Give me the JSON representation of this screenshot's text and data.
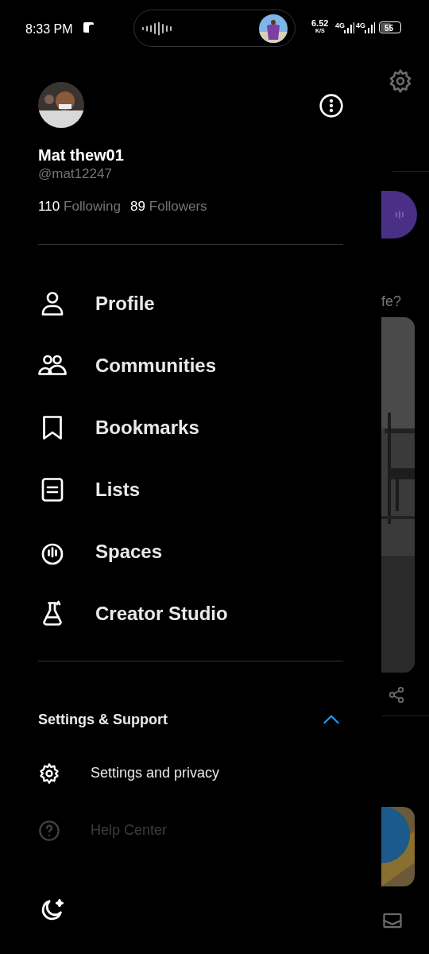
{
  "status_bar": {
    "time": "8:33 PM",
    "speed": "6.52",
    "speed_unit": "K/S",
    "network_1": "4G",
    "network_2": "4G",
    "battery": "55"
  },
  "profile": {
    "name": "Mat thew01",
    "handle": "@mat12247",
    "following_count": "110",
    "following_label": "Following",
    "followers_count": "89",
    "followers_label": "Followers"
  },
  "menu": [
    {
      "kind": "profile",
      "label": "Profile"
    },
    {
      "kind": "communities",
      "label": "Communities"
    },
    {
      "kind": "bookmarks",
      "label": "Bookmarks"
    },
    {
      "kind": "lists",
      "label": "Lists"
    },
    {
      "kind": "spaces",
      "label": "Spaces"
    },
    {
      "kind": "studio",
      "label": "Creator Studio"
    }
  ],
  "settings_section": {
    "title": "Settings & Support",
    "expanded": true,
    "items": [
      {
        "kind": "settings",
        "label": "Settings and privacy",
        "faded": false
      },
      {
        "kind": "help",
        "label": "Help Center",
        "faded": true
      }
    ]
  },
  "background_feed": {
    "post_text": "fe?"
  }
}
